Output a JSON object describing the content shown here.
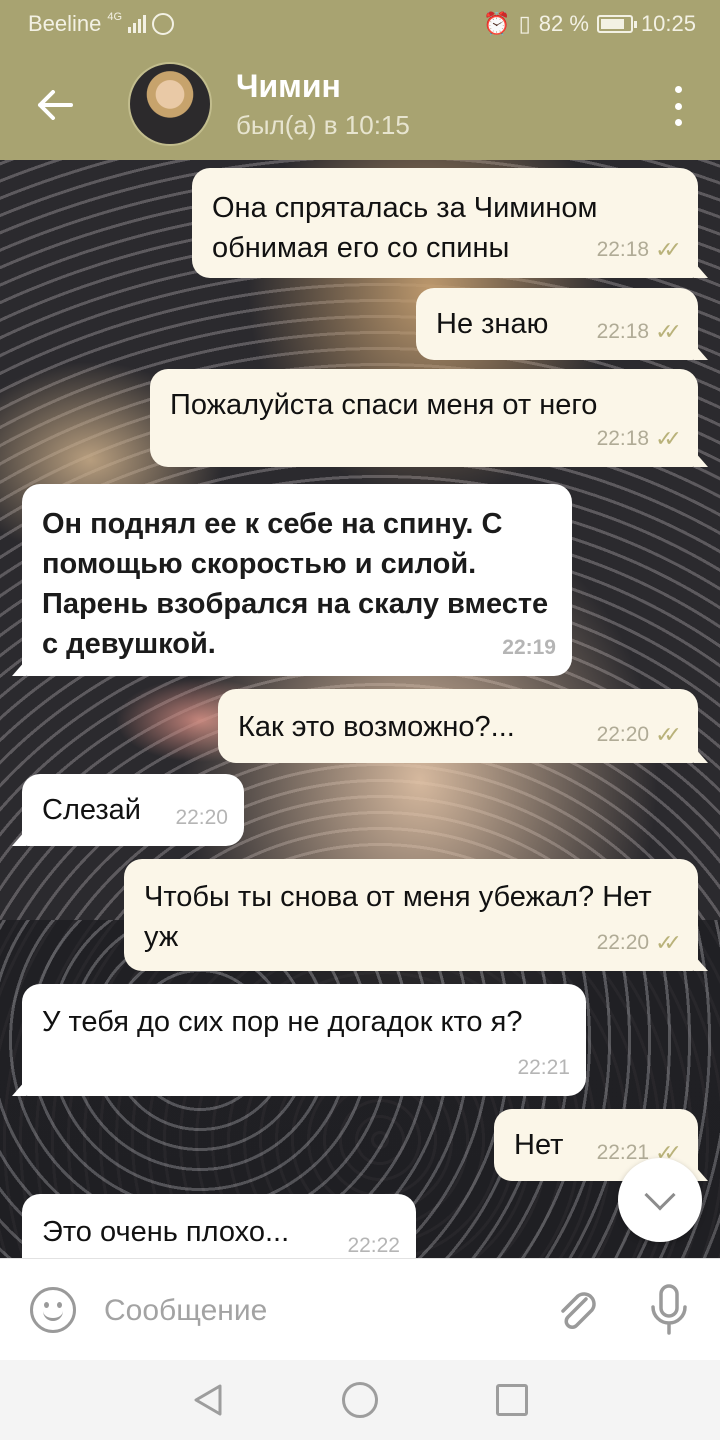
{
  "status_bar": {
    "carrier": "Beeline",
    "network": "4G",
    "battery_percent": "82 %",
    "time": "10:25"
  },
  "header": {
    "contact_name": "Чимин",
    "last_seen": "был(а) в 10:15"
  },
  "messages": [
    {
      "direction": "out",
      "text": "Она спряталась за Чимином обнимая его со спины",
      "time": "22:18"
    },
    {
      "direction": "out",
      "text": "Не знаю",
      "time": "22:18"
    },
    {
      "direction": "out",
      "text": "Пожалуйста спаси меня от него",
      "time": "22:18"
    },
    {
      "direction": "in",
      "text": "Он поднял ее к себе на спину. С помощью скоростью и силой. Парень взобрался на скалу вместе с девушкой.",
      "time": "22:19"
    },
    {
      "direction": "out",
      "text": "Как это возможно?...",
      "time": "22:20"
    },
    {
      "direction": "in",
      "text": "Слезай",
      "time": "22:20"
    },
    {
      "direction": "out",
      "text": "Чтобы ты снова от меня убежал? Нет уж",
      "time": "22:20"
    },
    {
      "direction": "in",
      "text": "У тебя до сих пор не догадок кто я?",
      "time": "22:21"
    },
    {
      "direction": "out",
      "text": "Нет",
      "time": "22:21"
    },
    {
      "direction": "in",
      "text": "Это очень плохо...",
      "time": "22:22"
    }
  ],
  "read_receipt_icon": "double-check-icon",
  "input": {
    "placeholder": "Сообщение",
    "value": ""
  },
  "colors": {
    "header_bg": "#a8a371",
    "outgoing_bubble": "#fbf6e8",
    "incoming_bubble": "#ffffff",
    "check_color": "#b9b27a"
  }
}
